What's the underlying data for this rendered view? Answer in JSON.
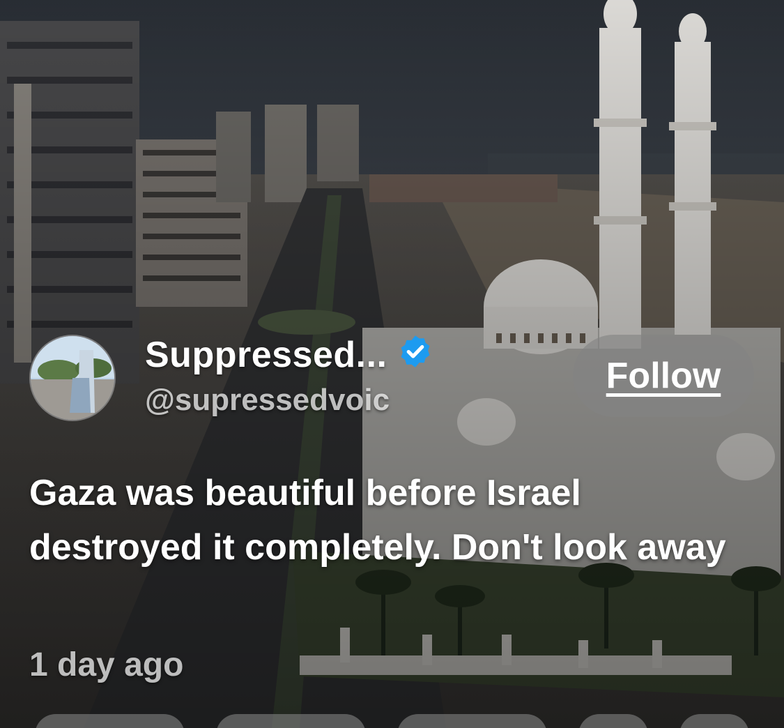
{
  "post": {
    "author": {
      "display_name": "Suppressed...",
      "handle": "@supressedvoic",
      "verified": true,
      "verified_color": "#1d9bf0"
    },
    "follow_label": "Follow",
    "text": "Gaza was beautiful before Israel destroyed it completely. Don't look away",
    "timestamp": "1 day ago"
  },
  "icons": {
    "verified": "verified-badge-icon"
  },
  "colors": {
    "text": "#ffffff",
    "muted_text": "#b8b8b8",
    "button_bg": "#828282"
  }
}
